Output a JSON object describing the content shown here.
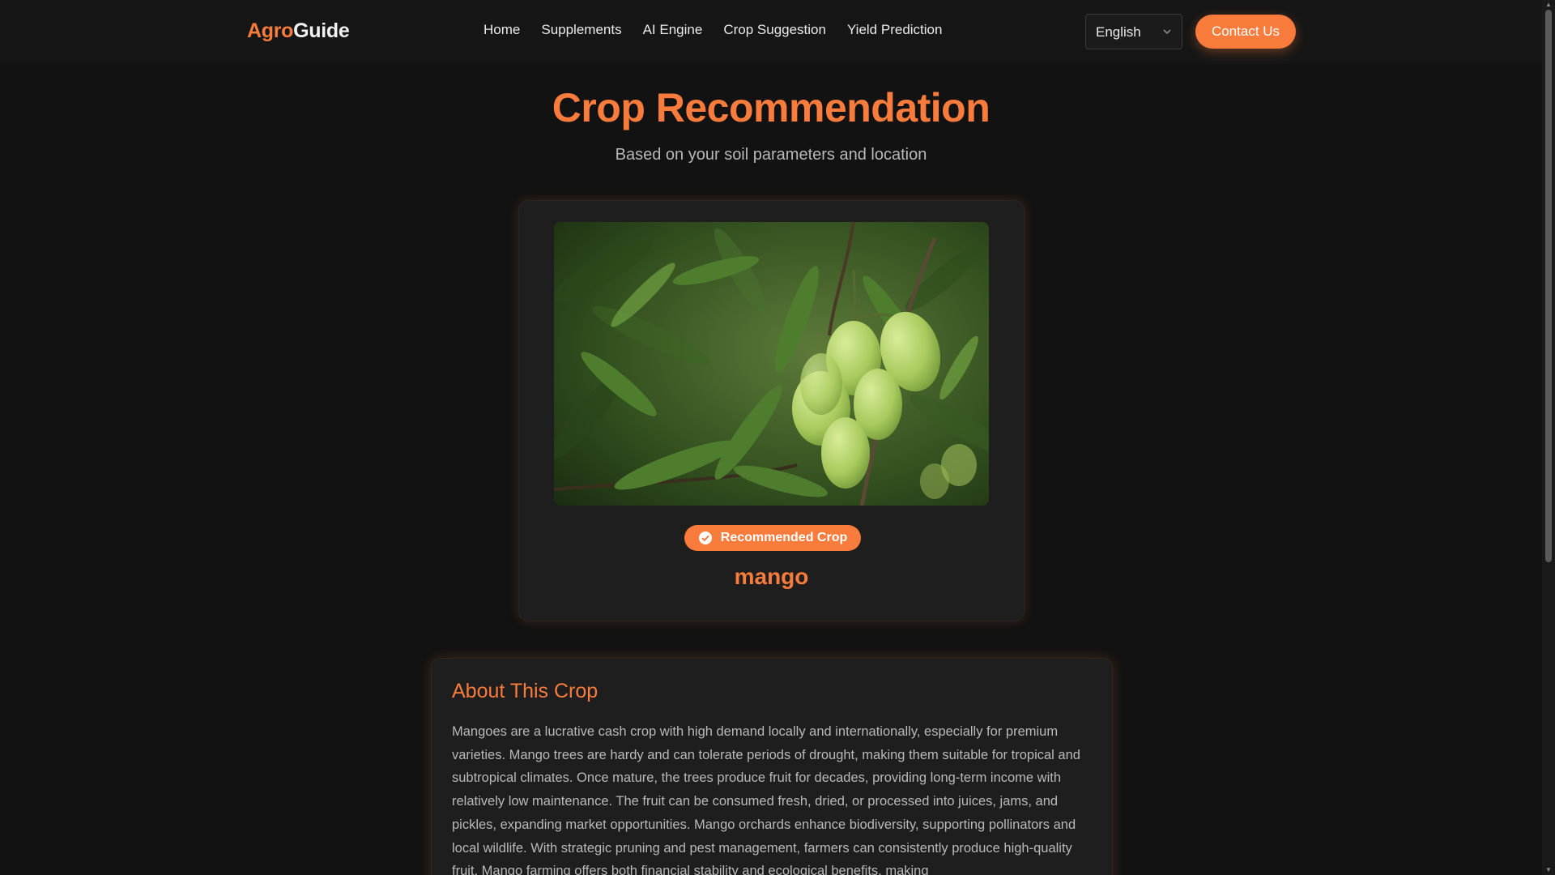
{
  "app": {
    "logo_accent": "Agro",
    "logo_rest": "Guide",
    "accent_color": "#f97c3c",
    "background_color": "#121212"
  },
  "nav": {
    "links": [
      "Home",
      "Supplements",
      "AI Engine",
      "Crop Suggestion",
      "Yield Prediction"
    ],
    "language": "English",
    "language_icon": "chevron-down-icon",
    "contact_label": "Contact Us"
  },
  "hero": {
    "title": "Crop Recommendation",
    "subtitle": "Based on your soil parameters and location"
  },
  "result": {
    "image_subject": "mango fruit on tree",
    "badge_icon": "check-circle-icon",
    "badge_label": "Recommended Crop",
    "crop_name": "mango"
  },
  "about": {
    "title": "About This Crop",
    "text": "Mangoes are a lucrative cash crop with high demand locally and internationally, especially for premium varieties. Mango trees are hardy and can tolerate periods of drought, making them suitable for tropical and subtropical climates. Once mature, the trees produce fruit for decades, providing long-term income with relatively low maintenance. The fruit can be consumed fresh, dried, or processed into juices, jams, and pickles, expanding market opportunities. Mango orchards enhance biodiversity, supporting pollinators and local wildlife. With strategic pruning and pest management, farmers can consistently produce high-quality fruit. Mango farming offers both financial stability and ecological benefits, making"
  }
}
